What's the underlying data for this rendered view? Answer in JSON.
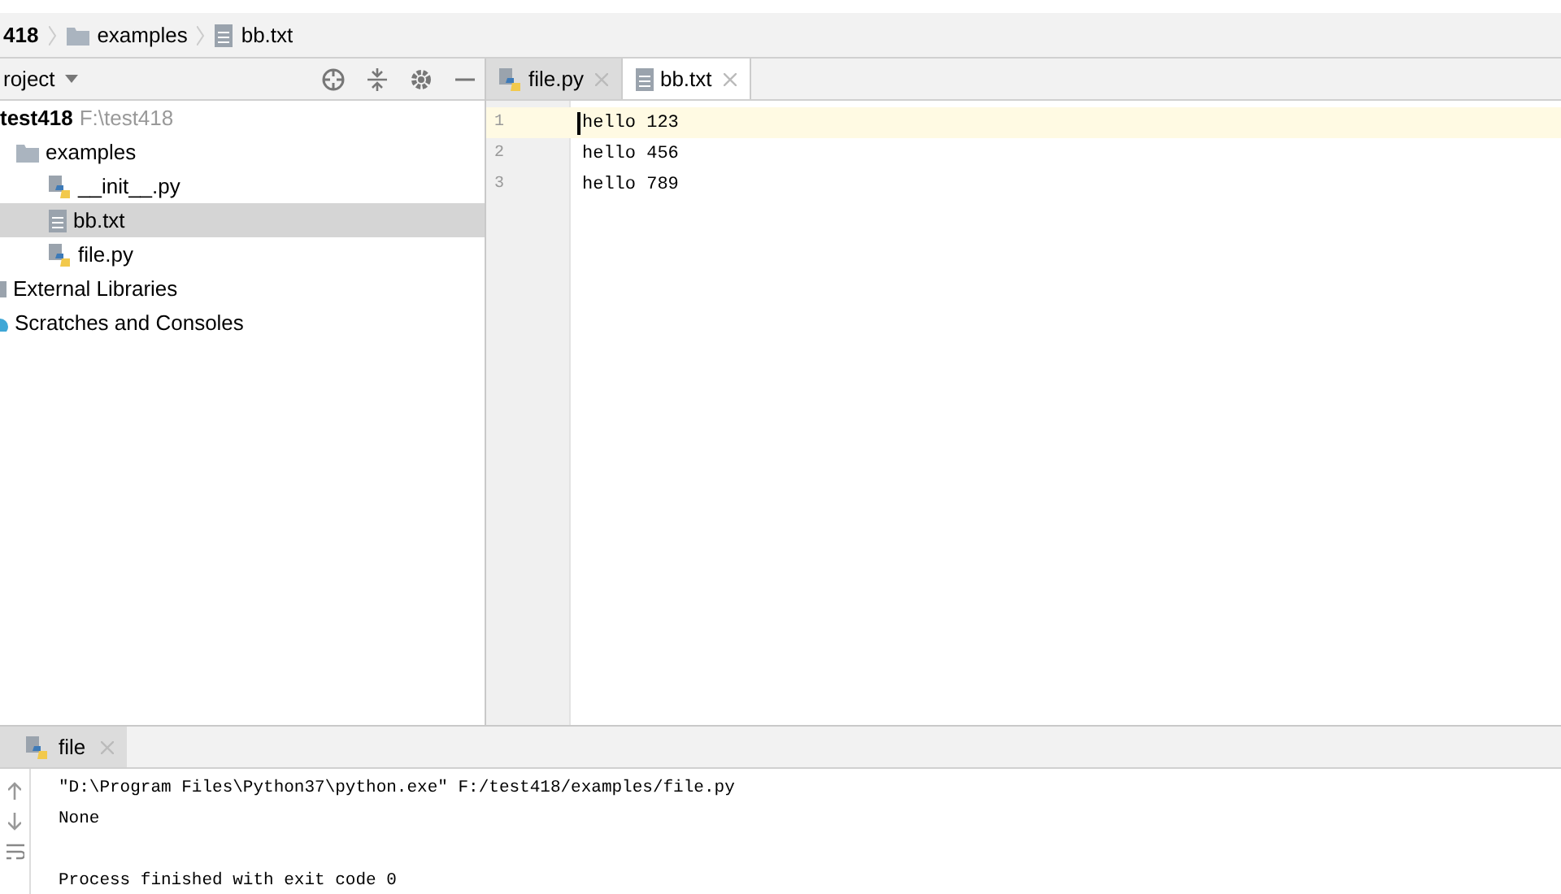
{
  "breadcrumb": [
    {
      "label": "418",
      "kind": "project"
    },
    {
      "label": "examples",
      "kind": "folder"
    },
    {
      "label": "bb.txt",
      "kind": "text"
    }
  ],
  "project_panel": {
    "title": "roject",
    "tree": [
      {
        "label": "test418",
        "note": "F:\\test418",
        "kind": "root",
        "selected": false,
        "children": [
          {
            "label": "examples",
            "kind": "folder",
            "selected": false,
            "children": [
              {
                "label": "__init__.py",
                "kind": "python",
                "selected": false
              },
              {
                "label": "bb.txt",
                "kind": "text",
                "selected": true
              },
              {
                "label": "file.py",
                "kind": "python",
                "selected": false
              }
            ]
          }
        ]
      },
      {
        "label": "External Libraries",
        "kind": "library",
        "selected": false
      },
      {
        "label": "Scratches and Consoles",
        "kind": "scratch",
        "selected": false
      }
    ]
  },
  "editor_tabs": [
    {
      "label": "file.py",
      "kind": "python",
      "selected": false
    },
    {
      "label": "bb.txt",
      "kind": "text",
      "selected": true
    }
  ],
  "editor_lines": [
    {
      "number": "1",
      "text": "hello 123",
      "current": true
    },
    {
      "number": "2",
      "text": "hello 456",
      "current": false
    },
    {
      "number": "3",
      "text": "hello 789",
      "current": false
    }
  ],
  "run_panel": {
    "tab": "file",
    "output_blocks": [
      [
        "\"D:\\Program Files\\Python37\\python.exe\" F:/test418/examples/file.py",
        "None"
      ],
      [
        "Process finished with exit code 0"
      ]
    ]
  }
}
